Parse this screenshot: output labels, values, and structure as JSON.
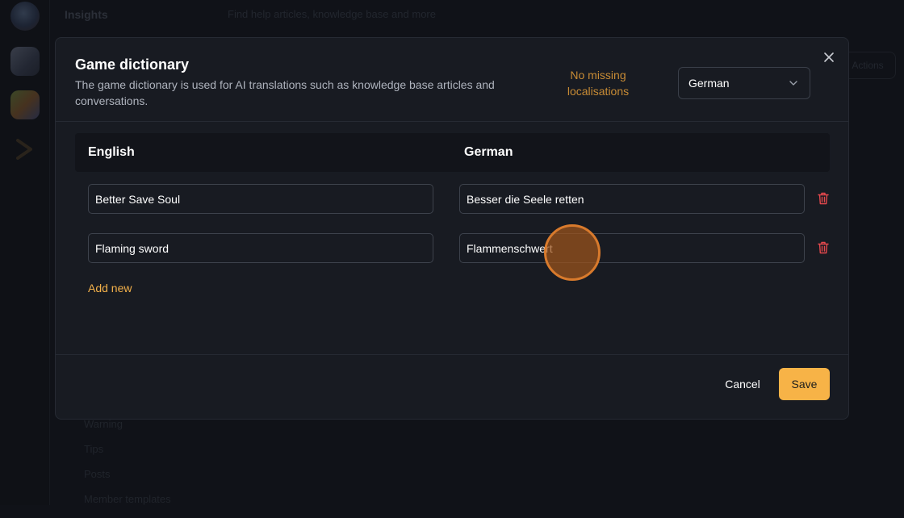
{
  "background": {
    "header_title": "Insights",
    "search_hint": "Find help articles, knowledge base and more",
    "right_button": "Actions",
    "list_items": [
      "Warning",
      "Tips",
      "Posts",
      "Member templates"
    ]
  },
  "modal": {
    "title": "Game dictionary",
    "description": "The game dictionary is used for AI translations such as knowledge base articles and conversations.",
    "status": "No missing localisations",
    "language_select": {
      "selected": "German"
    },
    "columns": {
      "source": "English",
      "target": "German"
    },
    "rows": [
      {
        "source": "Better Save Soul",
        "target": "Besser die Seele retten"
      },
      {
        "source": "Flaming sword",
        "target": "Flammenschwert"
      }
    ],
    "add_new_label": "Add new",
    "cancel_label": "Cancel",
    "save_label": "Save"
  },
  "colors": {
    "accent": "#f7b347",
    "link": "#f2b04a",
    "status": "#c78b35",
    "danger": "#e5484d",
    "modal_bg": "#181b22"
  },
  "icons": {
    "close": "close-icon",
    "chevron": "chevron-down-icon",
    "trash": "trash-icon"
  }
}
